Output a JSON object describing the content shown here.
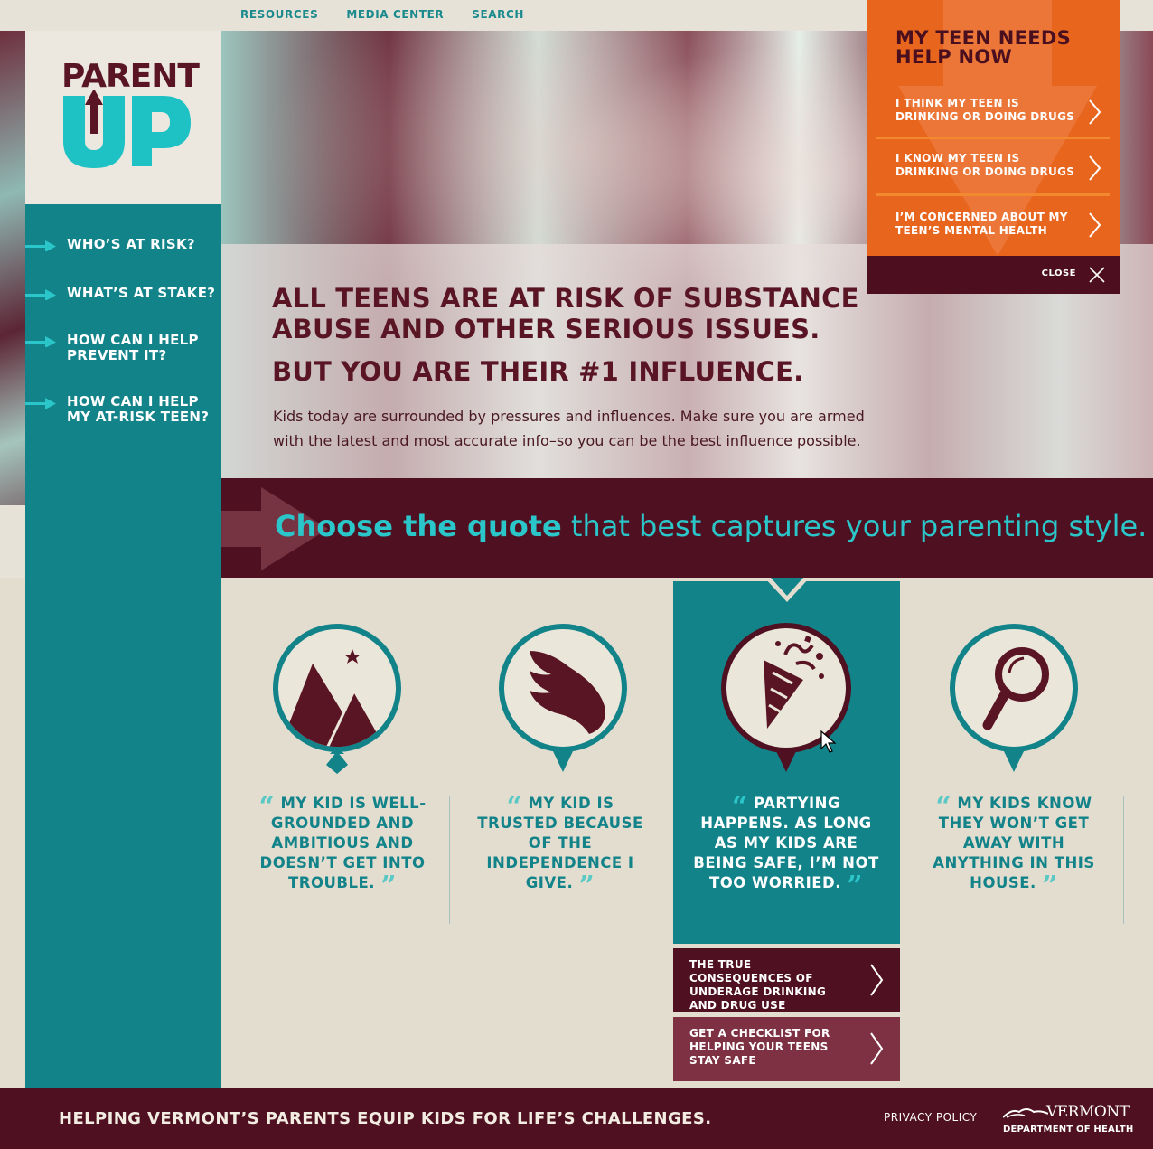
{
  "top_nav": [
    "RESOURCES",
    "MEDIA CENTER",
    "SEARCH"
  ],
  "logo": {
    "parent": "PARENT",
    "up": "UP"
  },
  "sidebar": {
    "items": [
      {
        "label": "WHO’S AT RISK?"
      },
      {
        "label": "WHAT’S AT STAKE?"
      },
      {
        "label": "HOW CAN I HELP PREVENT IT?"
      },
      {
        "label": "HOW CAN I HELP MY AT-RISK TEEN?"
      }
    ]
  },
  "hero": {
    "headline": "ALL TEENS ARE AT RISK OF SUBSTANCE ABUSE AND OTHER SERIOUS ISSUES.",
    "subhead": "BUT YOU ARE THEIR #1 INFLUENCE.",
    "body": "Kids today are surrounded by pressures and influences. Make sure you are armed with the latest and most accurate info–so you can be the best influence possible."
  },
  "help_panel": {
    "title": "MY TEEN NEEDS HELP NOW",
    "items": [
      {
        "label": "I THINK MY TEEN IS DRINKING OR DOING DRUGS"
      },
      {
        "label": "I KNOW MY TEEN IS DRINKING OR DOING DRUGS"
      },
      {
        "label": "I’M CONCERNED ABOUT MY TEEN’S MENTAL HEALTH"
      }
    ],
    "close_label": "CLOSE"
  },
  "banner": {
    "bold": "Choose the quote",
    "rest": " that best captures your parenting style."
  },
  "quotes": [
    {
      "icon": "mountain-icon",
      "text": "MY KID IS WELL-GROUNDED AND AMBITIOUS AND DOESN’T GET INTO TROUBLE.",
      "selected": false
    },
    {
      "icon": "wing-icon",
      "text": "MY KID IS TRUSTED BECAUSE OF THE INDEPENDENCE I GIVE.",
      "selected": false
    },
    {
      "icon": "party-popper-icon",
      "text": "PARTYING HAPPENS. AS LONG AS MY KIDS ARE BEING SAFE, I’M NOT TOO WORRIED.",
      "selected": true
    },
    {
      "icon": "magnifying-glass-icon",
      "text": "MY KIDS KNOW THEY WON’T GET AWAY WITH ANYTHING IN THIS HOUSE.",
      "selected": false
    }
  ],
  "selected_links": [
    {
      "label": "THE TRUE CONSEQUENCES OF UNDERAGE DRINKING AND DRUG USE"
    },
    {
      "label": "GET A CHECKLIST FOR HELPING YOUR TEENS STAY SAFE"
    }
  ],
  "footer": {
    "tagline": "HELPING VERMONT’S PARENTS EQUIP KIDS FOR LIFE’S CHALLENGES.",
    "privacy": "PRIVACY POLICY",
    "vermont": "VERMONT",
    "department": "DEPARTMENT OF HEALTH"
  },
  "colors": {
    "teal": "#13838a",
    "maroon": "#4f1121",
    "orange": "#e8651e",
    "cream": "#e3ddd0",
    "aqua": "#2bc6c9"
  }
}
